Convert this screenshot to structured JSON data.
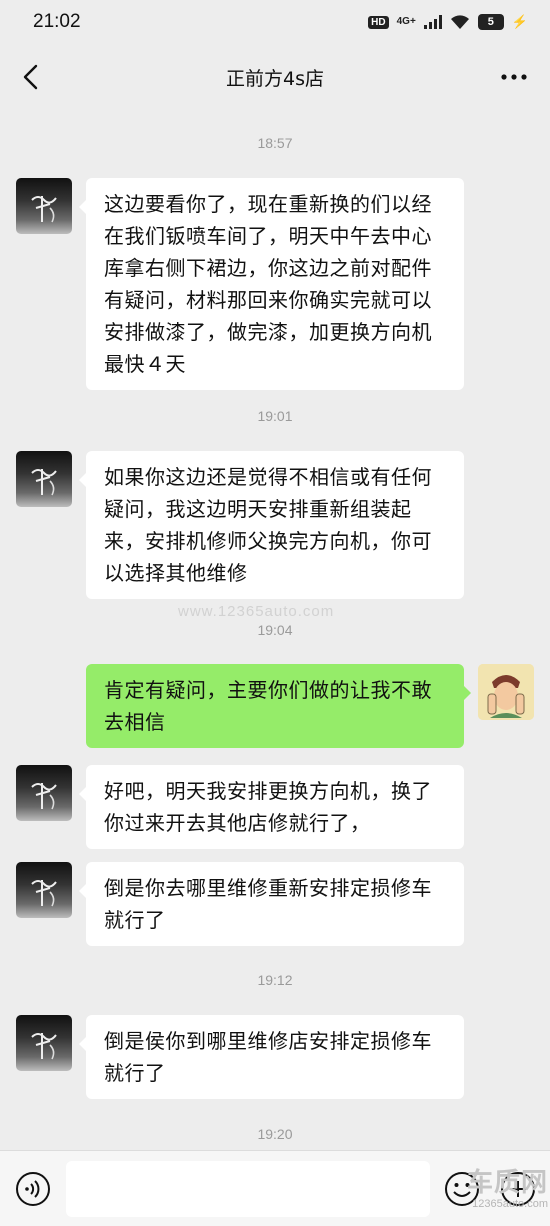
{
  "status_bar": {
    "time": "21:02",
    "hd": "HD",
    "network": "4G+",
    "battery": "5"
  },
  "header": {
    "title": "正前方4s店"
  },
  "messages": [
    {
      "type": "timestamp",
      "text": "18:57"
    },
    {
      "type": "incoming",
      "text": "这边要看你了，现在重新换的们以经在我们钣喷车间了，明天中午去中心库拿右侧下裙边，你这边之前对配件有疑问，材料那回来你确实完就可以安排做漆了，做完漆，加更换方向机最快４天"
    },
    {
      "type": "timestamp",
      "text": "19:01"
    },
    {
      "type": "incoming",
      "text": "如果你这边还是觉得不相信或有任何疑问，我这边明天安排重新组装起来，安排机修师父换完方向机，你可以选择其他维修"
    },
    {
      "type": "timestamp",
      "text": "19:04"
    },
    {
      "type": "outgoing",
      "text": "肯定有疑问，主要你们做的让我不敢去相信"
    },
    {
      "type": "incoming",
      "text": "好吧，明天我安排更换方向机，换了你过来开去其他店修就行了，"
    },
    {
      "type": "incoming",
      "text": "倒是你去哪里维修重新安排定损修车就行了"
    },
    {
      "type": "timestamp",
      "text": "19:12"
    },
    {
      "type": "incoming",
      "text": "倒是侯你到哪里维修店安排定损修车就行了"
    },
    {
      "type": "timestamp",
      "text": "19:20"
    }
  ],
  "watermark": {
    "center_text": "www.12365auto.com",
    "logo_main": "车质网",
    "logo_sub": "12365auto.com"
  },
  "colors": {
    "background": "#ededed",
    "incoming_bubble": "#ffffff",
    "outgoing_bubble": "#95ec69",
    "timestamp_text": "#9a9a9a"
  }
}
